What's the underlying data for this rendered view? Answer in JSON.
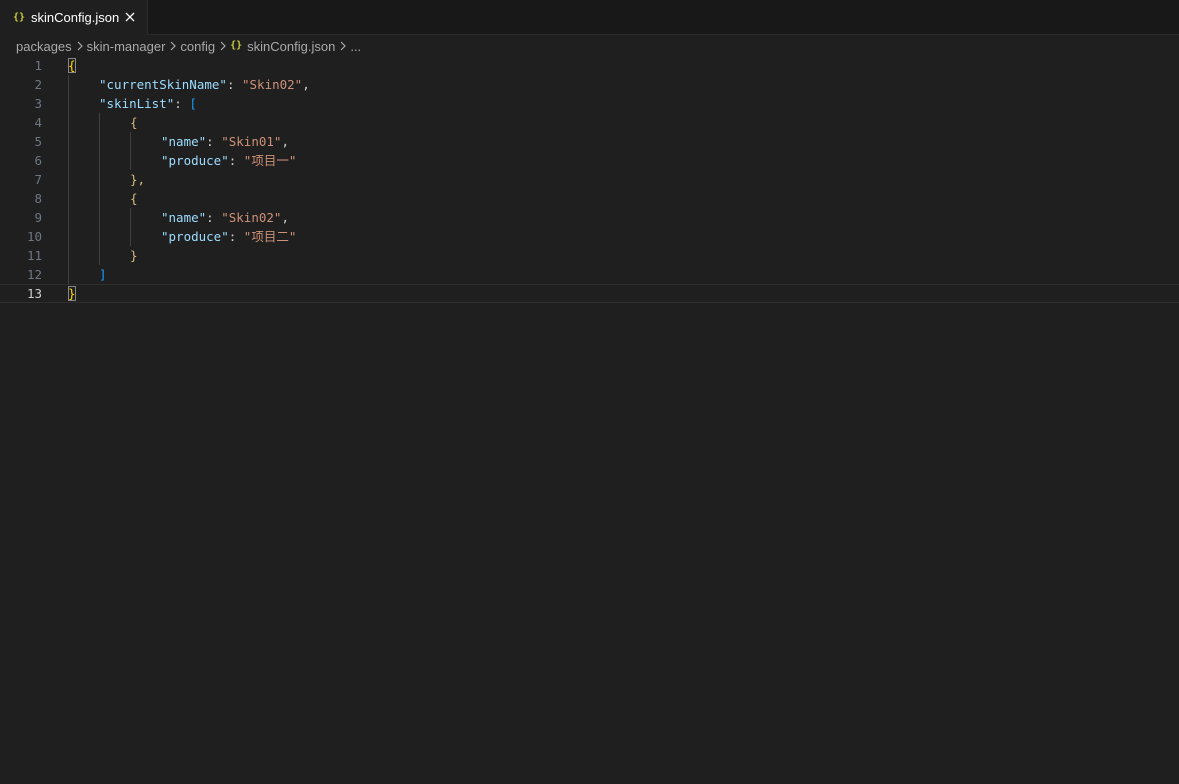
{
  "tab": {
    "icon": "{}",
    "label": "skinConfig.json",
    "close": "×"
  },
  "breadcrumb": {
    "items": [
      "packages",
      "skin-manager",
      "config"
    ],
    "file_icon": "{}",
    "file": "skinConfig.json",
    "more": "..."
  },
  "editor": {
    "current_line": 13,
    "line_numbers": [
      "1",
      "2",
      "3",
      "4",
      "5",
      "6",
      "7",
      "8",
      "9",
      "10",
      "11",
      "12",
      "13"
    ],
    "lines": {
      "l2_key": "\"currentSkinName\"",
      "l2_val": "\"Skin02\"",
      "l3_key": "\"skinList\"",
      "l5_key": "\"name\"",
      "l5_val": "\"Skin01\"",
      "l6_key": "\"produce\"",
      "l6_val": "\"项目一\"",
      "l9_key": "\"name\"",
      "l9_val": "\"Skin02\"",
      "l10_key": "\"produce\"",
      "l10_val": "\"项目二\""
    },
    "punct": {
      "open_brace": "{",
      "close_brace": "}",
      "open_bracket": "[",
      "close_bracket": "]",
      "colon": ": ",
      "comma": ",",
      "close_brace_comma": "},"
    }
  },
  "colors": {
    "background": "#1f1f1f",
    "tabbar": "#181818",
    "json_icon": "#cbcb41",
    "key": "#9cdcfe",
    "string": "#ce9178",
    "bracket_level1": "#ffd700",
    "bracket_level2": "#179fff",
    "bracket_level3": "#d7ba7d"
  }
}
